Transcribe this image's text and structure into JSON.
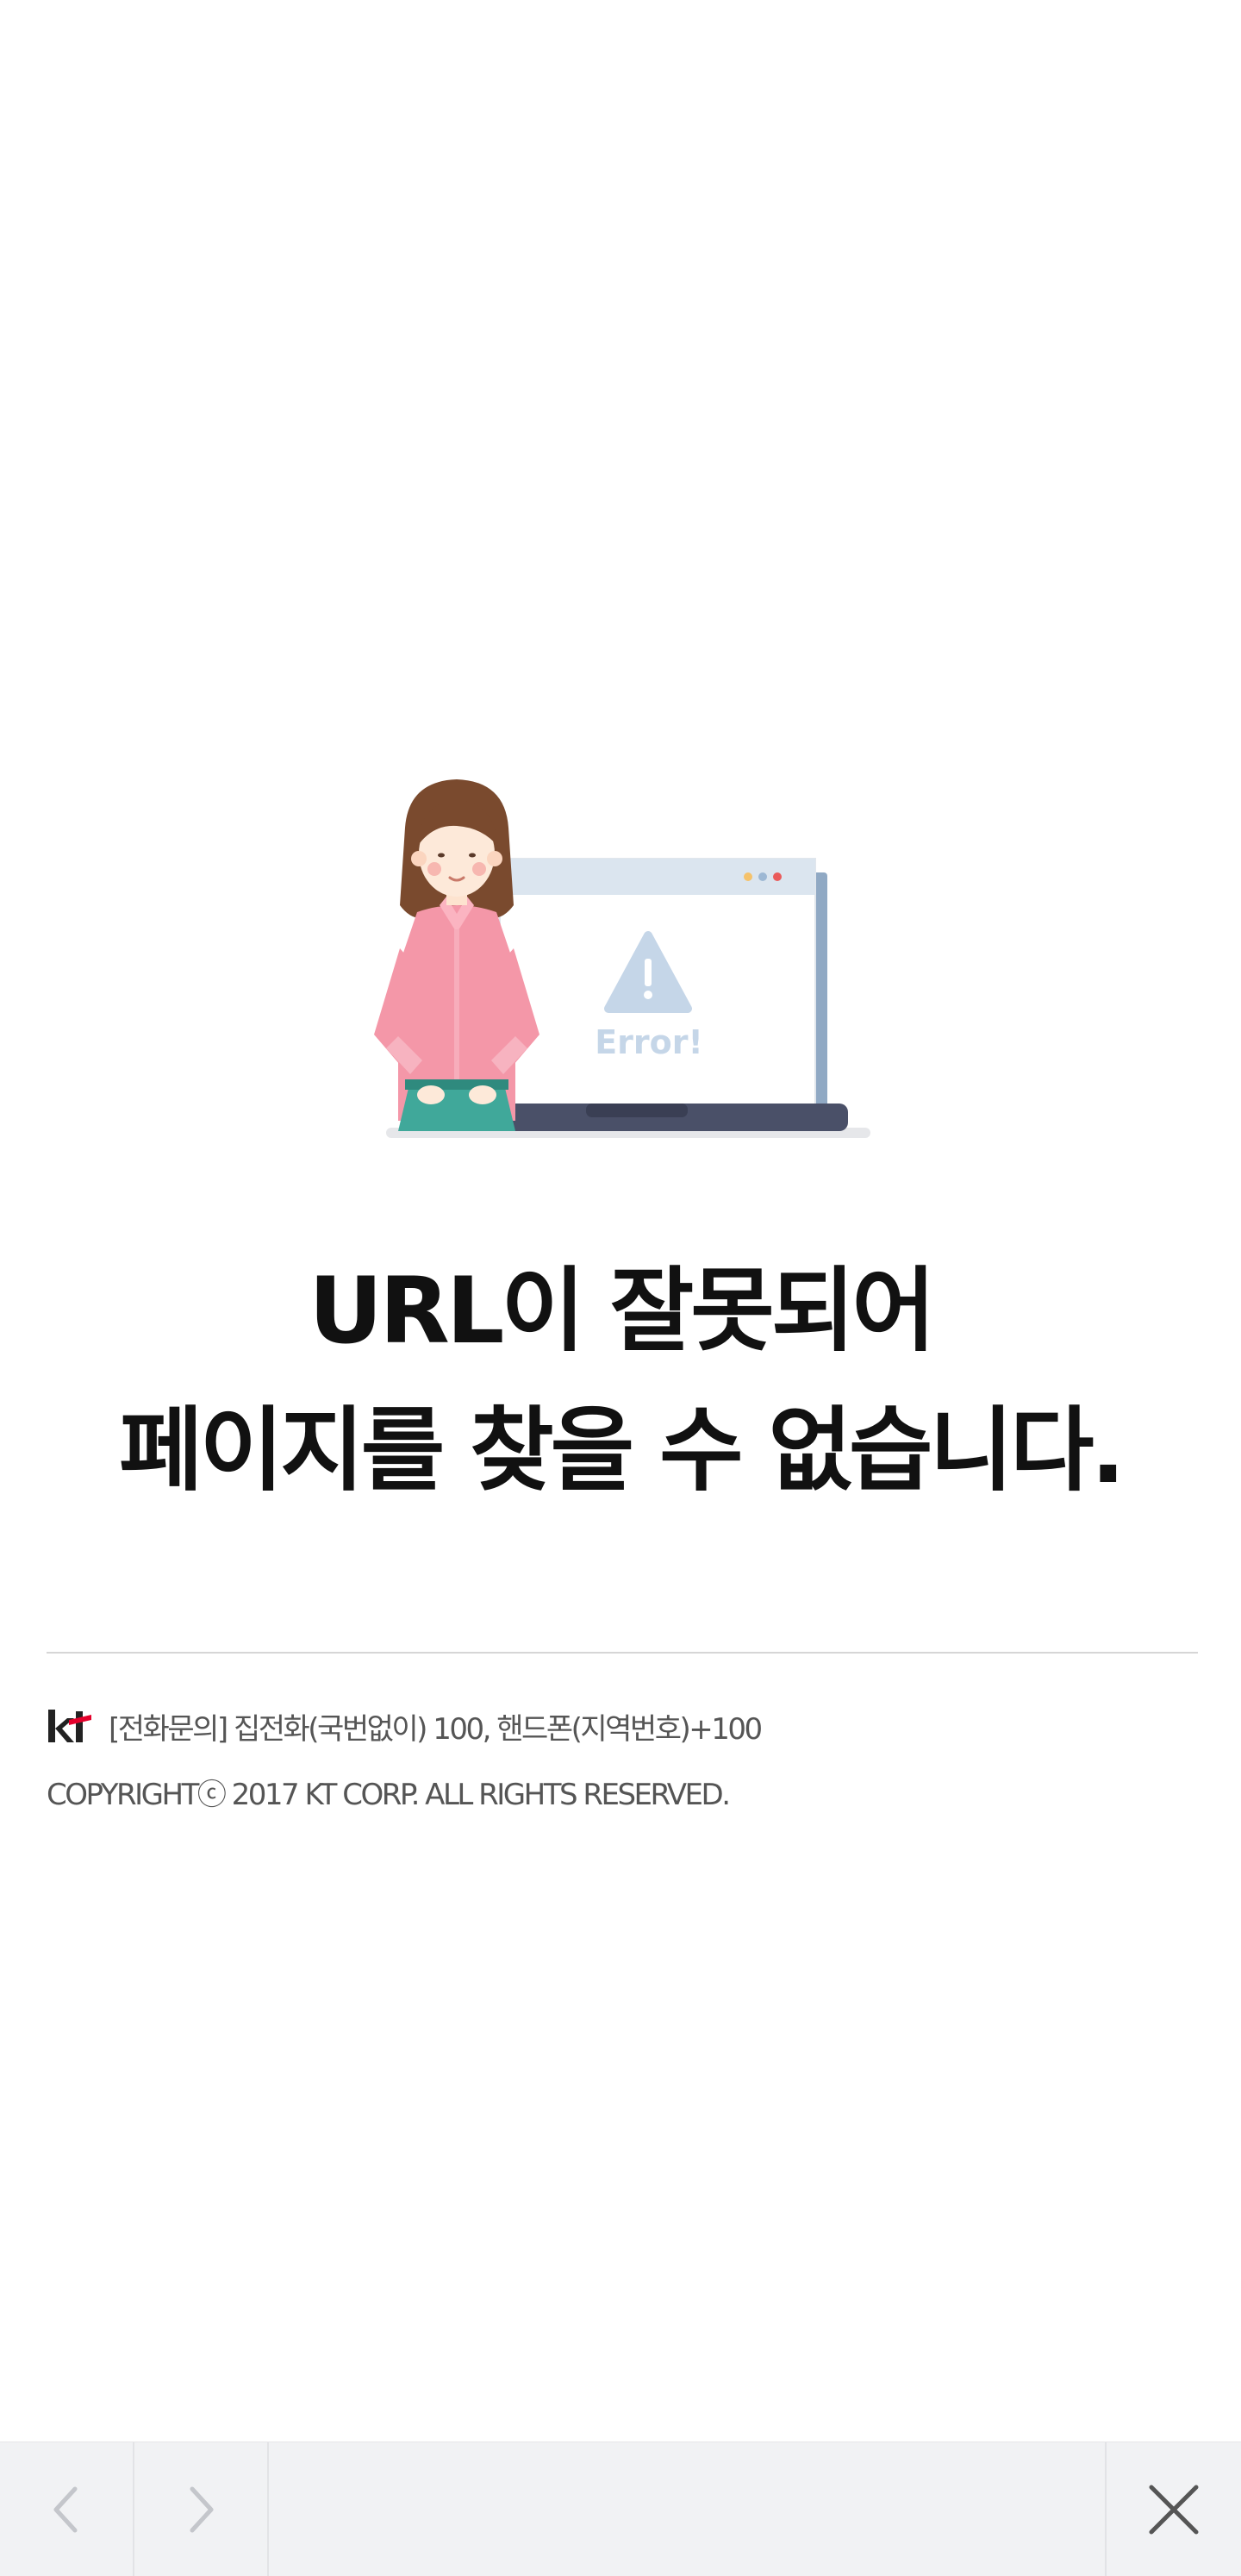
{
  "error": {
    "illustration_label": "Error!",
    "title_line1": "URL이 잘못되어",
    "title_line2": "페이지를 찾을 수 없습니다."
  },
  "footer": {
    "logo": "kt",
    "contact": "[전화문의] 집전화(국번없이) 100, 핸드폰(지역번호)+100",
    "copyright": "COPYRIGHTⓒ 2017 KT CORP. ALL RIGHTS RESERVED."
  },
  "toolbar": {
    "back_icon": "chevron-left-icon",
    "forward_icon": "chevron-right-icon",
    "close_icon": "close-icon"
  },
  "colors": {
    "shirt": "#f497a8",
    "browser_bar": "#dbe5ef",
    "laptop_base": "#4a5068",
    "warning": "#c5d6e8",
    "footer_text": "#555555",
    "toolbar_bg": "#f1f2f4"
  }
}
